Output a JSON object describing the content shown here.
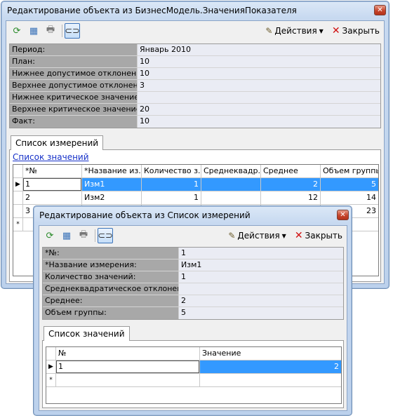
{
  "win1": {
    "title": "Редактирование объекта  из БизнесМодель.ЗначенияПоказателя",
    "toolbar": {
      "actions_label": "Действия",
      "close_label": "Закрыть"
    },
    "props": [
      {
        "name": "Период:",
        "value": "Январь 2010"
      },
      {
        "name": "План:",
        "value": "10"
      },
      {
        "name": "Нижнее допустимое отклонение:",
        "value": "10"
      },
      {
        "name": "Верхнее допустимое отклонение:",
        "value": "3"
      },
      {
        "name": "Нижнее критическое значение:",
        "value": ""
      },
      {
        "name": "Верхнее критическое значение:",
        "value": "20"
      },
      {
        "name": "Факт:",
        "value": "10"
      }
    ],
    "tab_label": "Список измерений",
    "link_label": "Список значений",
    "grid": {
      "headers": [
        "*№",
        "*Название из...",
        "Количество з...",
        "Среднеквадр...",
        "Среднее",
        "Объем группы"
      ],
      "rows": [
        [
          "1",
          "Изм1",
          "1",
          "",
          "2",
          "5"
        ],
        [
          "2",
          "Изм2",
          "1",
          "",
          "12",
          "14"
        ],
        [
          "3",
          "",
          "",
          "",
          "",
          "23"
        ]
      ],
      "new_row_marker": "*"
    }
  },
  "win2": {
    "title": "Редактирование объекта  из Список измерений",
    "toolbar": {
      "actions_label": "Действия",
      "close_label": "Закрыть"
    },
    "props": [
      {
        "name": "*№:",
        "value": "1"
      },
      {
        "name": "*Название измерения:",
        "value": "Изм1"
      },
      {
        "name": "Количество значений:",
        "value": "1"
      },
      {
        "name": "Среднеквадратическое отклонение:",
        "value": ""
      },
      {
        "name": "Среднее:",
        "value": "2"
      },
      {
        "name": "Объем группы:",
        "value": "5"
      }
    ],
    "tab_label": "Список значений",
    "grid": {
      "headers": [
        "№",
        "Значение"
      ],
      "rows": [
        [
          "1",
          "2"
        ]
      ],
      "new_row_marker": "*"
    }
  },
  "colors": {
    "selection": "#3399ff",
    "link": "#1530c8",
    "close_x": "#d01010"
  },
  "icons": [
    "refresh-icon",
    "table-icon",
    "print-icon",
    "link-icon",
    "actions-icon",
    "close-icon",
    "row-pointer-icon"
  ]
}
